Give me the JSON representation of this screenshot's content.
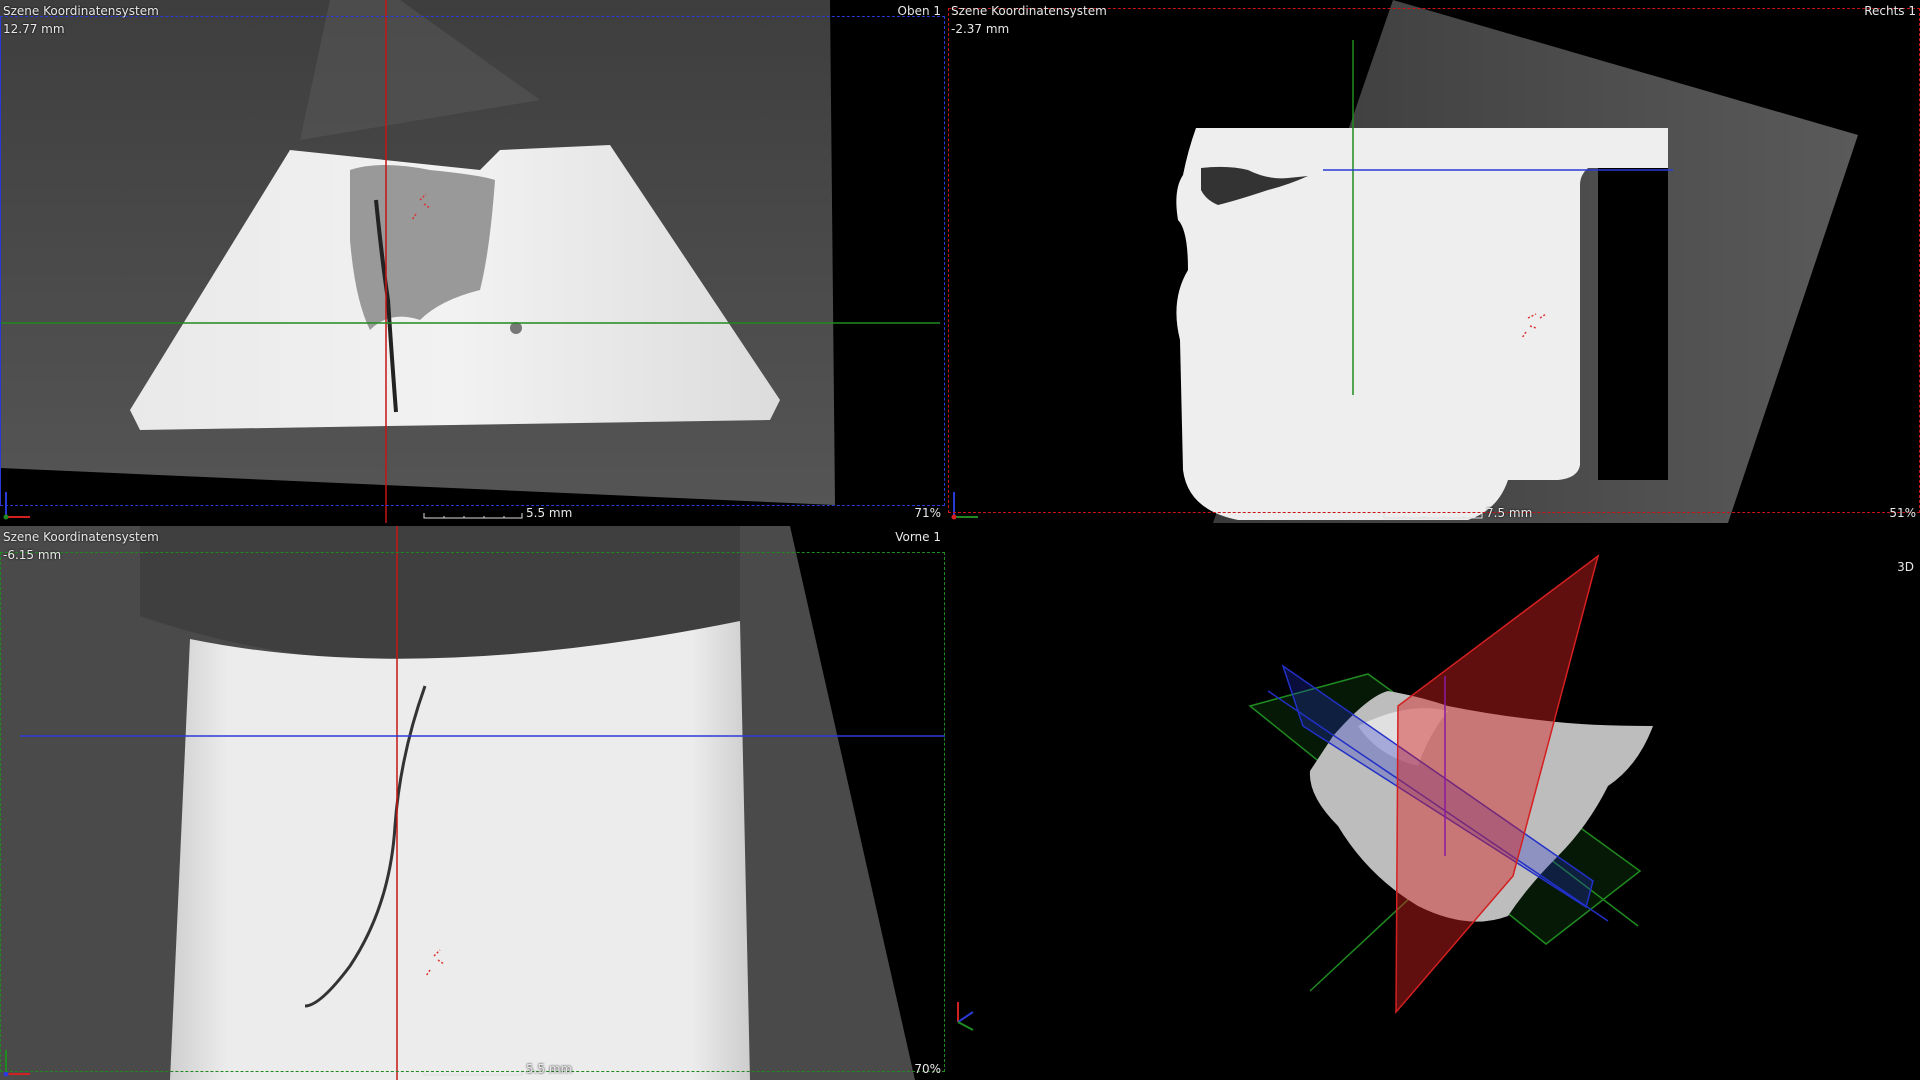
{
  "views": {
    "top": {
      "system": "Szene Koordinatensystem",
      "depth": "12.77 mm",
      "name": "Oben 1",
      "scale": "5.5 mm",
      "zoom": "71%"
    },
    "right": {
      "system": "Szene Koordinatensystem",
      "depth": "-2.37 mm",
      "name": "Rechts 1",
      "scale": "7.5 mm",
      "zoom": "51%"
    },
    "front": {
      "system": "Szene Koordinatensystem",
      "depth": "-6.15 mm",
      "name": "Vorne 1",
      "scale": "5.5 mm",
      "zoom": "70%"
    },
    "three_d": {
      "name": "3D"
    }
  },
  "colors": {
    "red_plane": "#d42020",
    "green_plane": "#1f8a1f",
    "blue_plane": "#2230c8",
    "label_text": "#e8e8e8"
  },
  "icons": [
    "axis-triad-icon",
    "region-marker-icon"
  ]
}
